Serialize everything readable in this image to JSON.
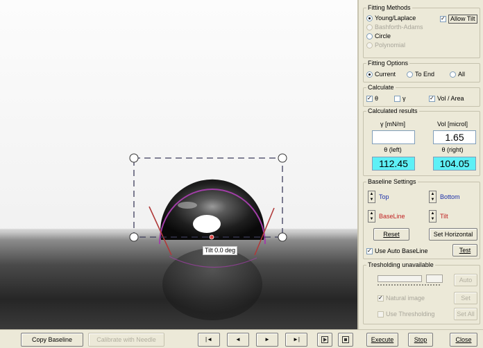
{
  "viewer": {
    "tilt_label": "Tilt 0.0 deg"
  },
  "fitting_methods": {
    "title": "Fitting Methods",
    "options": [
      {
        "label": "Young/Laplace",
        "selected": true,
        "enabled": true
      },
      {
        "label": "Bashforth-Adams",
        "selected": false,
        "enabled": false
      },
      {
        "label": "Circle",
        "selected": false,
        "enabled": true
      },
      {
        "label": "Polynomial",
        "selected": false,
        "enabled": false
      }
    ],
    "allow_tilt": {
      "label": "Allow Tilt",
      "checked": true
    }
  },
  "fitting_options": {
    "title": "Fitting Options",
    "options": [
      {
        "label": "Current",
        "selected": true
      },
      {
        "label": "To End",
        "selected": false
      },
      {
        "label": "All",
        "selected": false
      }
    ]
  },
  "calculate": {
    "title": "Calculate",
    "theta": {
      "label": "θ",
      "checked": true
    },
    "gamma": {
      "label": "γ",
      "checked": false
    },
    "vol_area": {
      "label": "Vol / Area",
      "checked": true
    }
  },
  "results": {
    "title": "Calculated results",
    "gamma_label": "γ [mN/m]",
    "gamma_value": "",
    "vol_label": "Vol [microl]",
    "vol_value": "1.65",
    "theta_left_label": "θ (left)",
    "theta_left_value": "112.45",
    "theta_right_label": "θ (right)",
    "theta_right_value": "104.05"
  },
  "baseline": {
    "title": "Baseline Settings",
    "top": "Top",
    "bottom": "Bottom",
    "baseline": "BaseLine",
    "tilt": "Tilt",
    "reset": "Reset",
    "set_horizontal": "Set Horizontal",
    "use_auto_baseline": {
      "label": "Use Auto BaseLine",
      "checked": true
    },
    "test": "Test"
  },
  "thresholding": {
    "title": "Tresholding unavailable",
    "auto": "Auto",
    "natural_image": {
      "label": "Natural image",
      "checked": true
    },
    "set": "Set",
    "use_thresholding": {
      "label": "Use Thresholding",
      "checked": false
    },
    "set_all": "Set All"
  },
  "bottom": {
    "copy_baseline": "Copy Baseline",
    "calibrate": "Calibrate with Needle",
    "first": "|◄",
    "prev": "◄",
    "next": "►",
    "last": "►|",
    "execute": "Execute",
    "stop": "Stop",
    "close": "Close"
  },
  "colors": {
    "result_highlight": "#5ef0f6",
    "top_label": "#1b2fa8",
    "baseline_label": "#c02020"
  }
}
